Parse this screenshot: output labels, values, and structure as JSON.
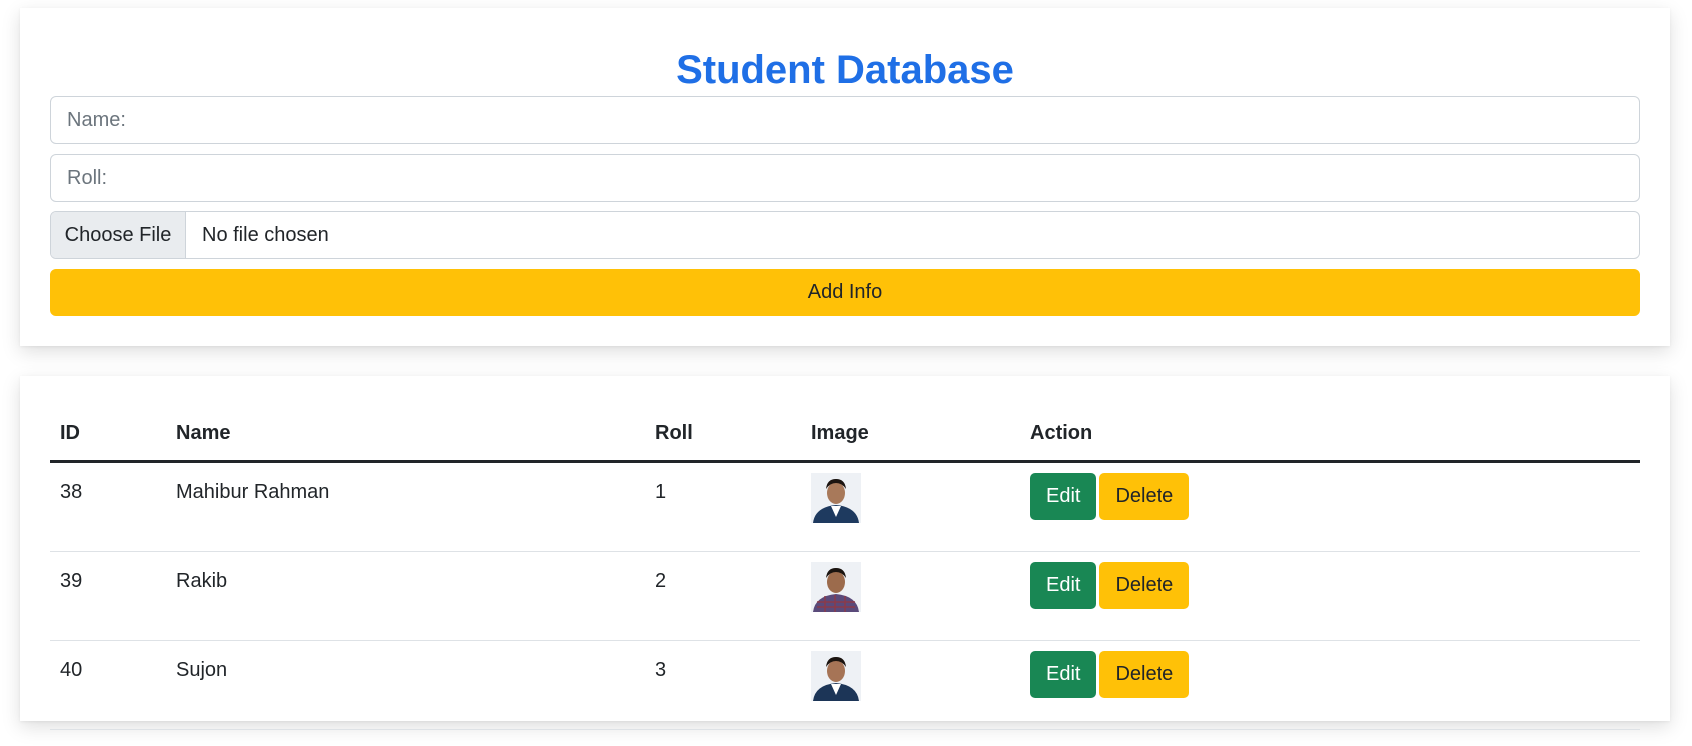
{
  "form": {
    "title": "Student Database",
    "name_placeholder": "Name:",
    "roll_placeholder": "Roll:",
    "file_button_label": "Choose File",
    "file_status": "No file chosen",
    "submit_label": "Add Info"
  },
  "table": {
    "headers": {
      "id": "ID",
      "name": "Name",
      "roll": "Roll",
      "image": "Image",
      "action": "Action"
    },
    "rows": [
      {
        "id": "38",
        "name": "Mahibur Rahman",
        "roll": "1",
        "shirt_color": "#1e3a5f",
        "edit_label": "Edit",
        "delete_label": "Delete"
      },
      {
        "id": "39",
        "name": "Rakib",
        "roll": "2",
        "shirt_color": "#5a4a7a",
        "edit_label": "Edit",
        "delete_label": "Delete"
      },
      {
        "id": "40",
        "name": "Sujon",
        "roll": "3",
        "shirt_color": "#1c3557",
        "edit_label": "Edit",
        "delete_label": "Delete"
      }
    ]
  },
  "colors": {
    "title": "#1f6fe6",
    "add_button": "#ffc107",
    "edit_button": "#198754",
    "delete_button": "#ffc107"
  }
}
